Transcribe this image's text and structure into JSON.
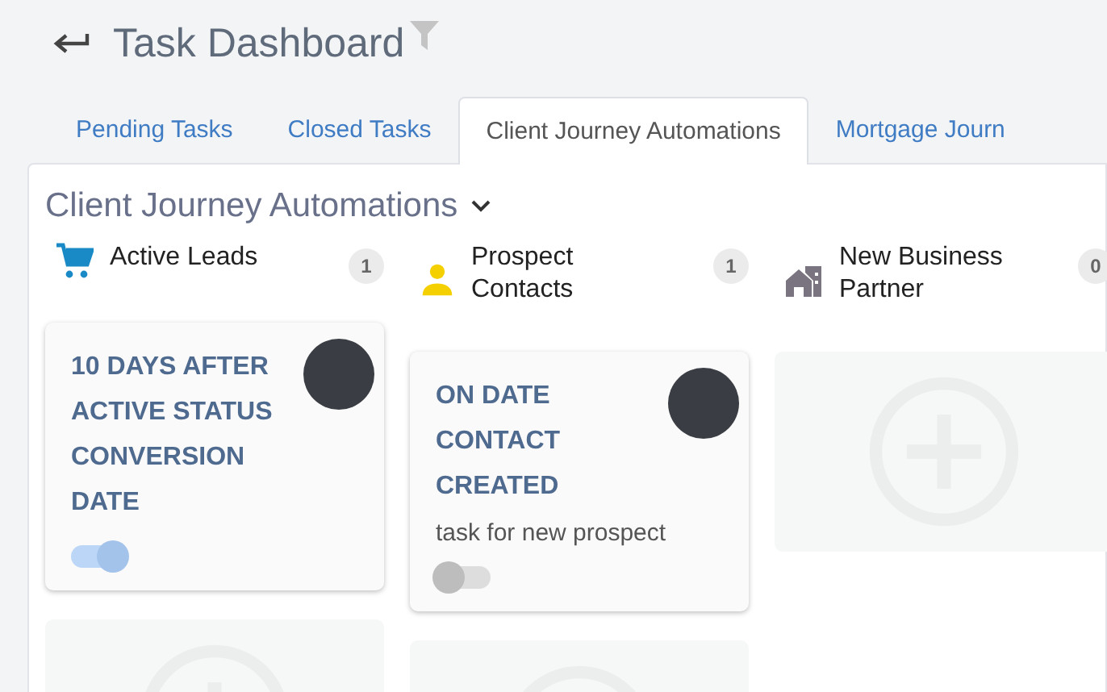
{
  "header": {
    "title": "Task Dashboard"
  },
  "tabs": [
    {
      "label": "Pending Tasks",
      "selected": false
    },
    {
      "label": "Closed Tasks",
      "selected": false
    },
    {
      "label": "Client Journey Automations",
      "selected": true
    },
    {
      "label": "Mortgage Journ",
      "selected": false
    }
  ],
  "panel": {
    "title": "Client Journey Automations",
    "columns": [
      {
        "kind": "cart",
        "title": "Active Leads",
        "count": "1",
        "cards": [
          {
            "kind": "task",
            "title": "10 DAYS AFTER ACTIVE STATUS CONVERSION DATE",
            "on": true
          },
          {
            "kind": "add"
          }
        ]
      },
      {
        "kind": "person",
        "title": "Prospect Contacts",
        "count": "1",
        "cards": [
          {
            "kind": "task",
            "title": "ON DATE CONTACT CREATED",
            "description": "task for new prospect",
            "on": false
          },
          {
            "kind": "add"
          }
        ]
      },
      {
        "kind": "building",
        "title": "New Business Partner",
        "count": "0",
        "cards": [
          {
            "kind": "add"
          }
        ]
      }
    ]
  }
}
